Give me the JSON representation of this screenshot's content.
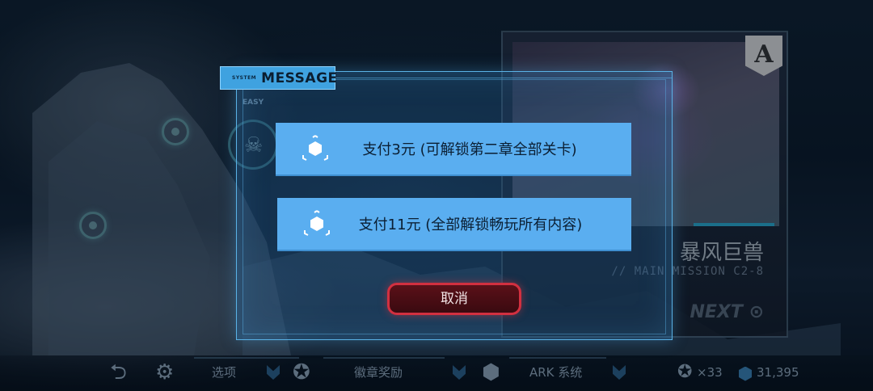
{
  "dialog": {
    "tab_small": "SYSTEM",
    "tab_title": "MESSAGE",
    "option_1": "支付3元 (可解锁第二章全部关卡)",
    "option_2": "支付11元 (全部解锁畅玩所有内容)",
    "cancel": "取消"
  },
  "background": {
    "difficulty": "EASY",
    "mission_rank": "A",
    "mission_name": "暴风巨兽",
    "mission_code": "// MAIN MISSION C2-8",
    "next_label": "NEXT"
  },
  "bottom_bar": {
    "options_label": "选项",
    "medals_label": "徽章奖励",
    "ark_label": "ARK 系统",
    "medal_count": "×33",
    "crystal_count": "31,395"
  },
  "colors": {
    "modal_border": "#5ab2e6",
    "option_button": "#5aaef0",
    "cancel_border": "#d23040",
    "tab": "#3fa2e0"
  }
}
